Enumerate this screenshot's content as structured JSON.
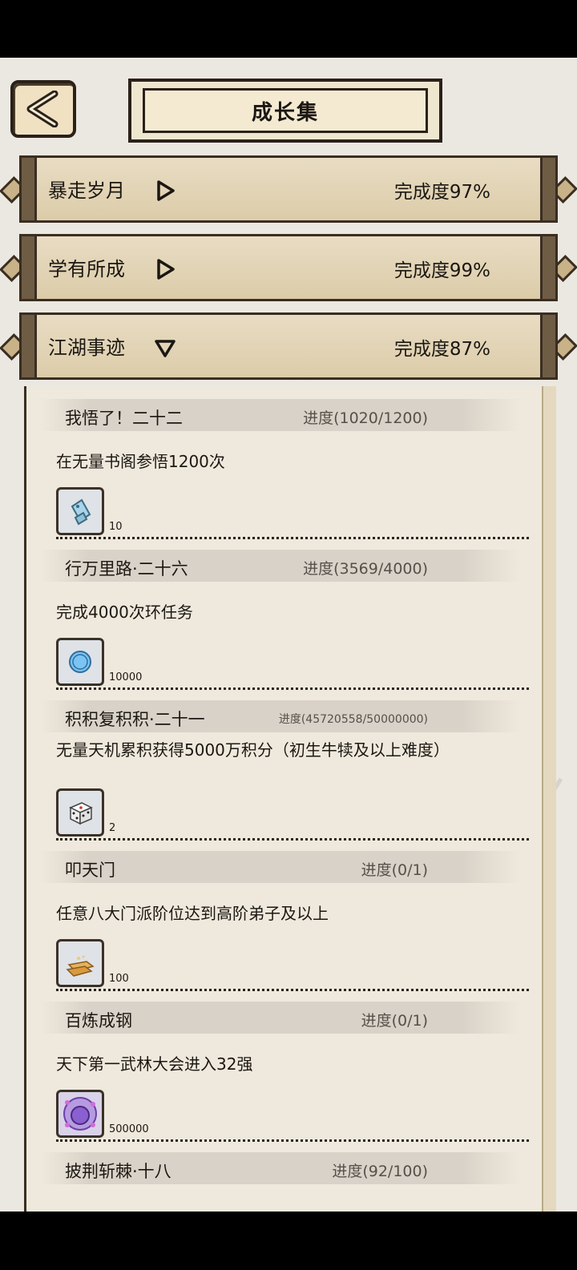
{
  "header": {
    "title": "成长集"
  },
  "categories": [
    {
      "name": "暴走岁月",
      "completion": "完成度97%",
      "expanded": false
    },
    {
      "name": "学有所成",
      "completion": "完成度99%",
      "expanded": false
    },
    {
      "name": "江湖事迹",
      "completion": "完成度87%",
      "expanded": true
    }
  ],
  "achievements": [
    {
      "name": "我悟了！二十二",
      "progress": "进度(1020/1200)",
      "desc": "在无量书阁参悟1200次",
      "reward_icon": "tag-ticket-icon",
      "reward_qty": "10"
    },
    {
      "name": "行万里路·二十六",
      "progress": "进度(3569/4000)",
      "desc": "完成4000次环任务",
      "reward_icon": "coin-icon",
      "reward_qty": "10000"
    },
    {
      "name": "积积复积积·二十一",
      "progress": "进度(45720558/50000000)",
      "desc": "无量天机累积获得5000万积分（初生牛犊及以上难度）",
      "reward_icon": "dice-icon",
      "reward_qty": "2"
    },
    {
      "name": "叩天门",
      "progress": "进度(0/1)",
      "desc": "任意八大门派阶位达到高阶弟子及以上",
      "reward_icon": "gold-ingot-icon",
      "reward_qty": "100"
    },
    {
      "name": "百炼成钢",
      "progress": "进度(0/1)",
      "desc": "天下第一武林大会进入32强",
      "reward_icon": "purple-orb-icon",
      "reward_qty": "500000"
    },
    {
      "name": "披荆斩棘·十八",
      "progress": "进度(92/100)"
    }
  ]
}
